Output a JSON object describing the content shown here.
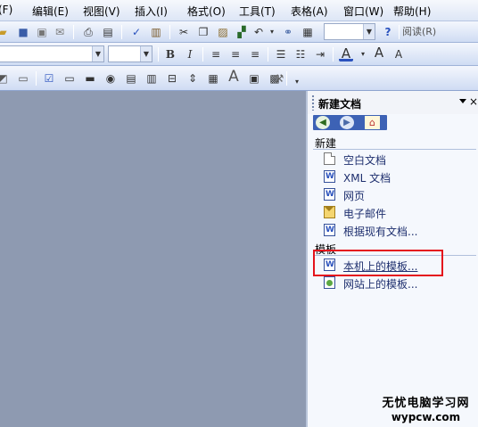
{
  "menubar": {
    "items": [
      {
        "label": "(F)"
      },
      {
        "label": "编辑(E)"
      },
      {
        "label": "视图(V)"
      },
      {
        "label": "插入(I)"
      },
      {
        "label": "格式(O)"
      },
      {
        "label": "工具(T)"
      },
      {
        "label": "表格(A)"
      },
      {
        "label": "窗口(W)"
      },
      {
        "label": "帮助(H)"
      }
    ]
  },
  "toolbar_standard": {
    "zoom_value": "",
    "read_label": "阅读(R)"
  },
  "toolbar_format": {
    "style_value": "",
    "font_size_value": "",
    "bold": "B",
    "italic": "I",
    "font_color": "A",
    "grow_font": "A",
    "shrink_font": "A"
  },
  "toolbar_forms": {
    "text_symbol": "A"
  },
  "task_pane": {
    "title": "新建文档",
    "close": "×",
    "section_new": "新建",
    "new_items": [
      {
        "label": "空白文档",
        "icon": "blank-document-icon"
      },
      {
        "label": "XML 文档",
        "icon": "xml-document-icon"
      },
      {
        "label": "网页",
        "icon": "web-page-icon"
      },
      {
        "label": "电子邮件",
        "icon": "email-icon"
      },
      {
        "label": "根据现有文档...",
        "icon": "existing-document-icon"
      }
    ],
    "section_templates": "模板",
    "template_items": [
      {
        "label": "本机上的模板...",
        "icon": "local-template-icon"
      },
      {
        "label": "网站上的模板...",
        "icon": "web-template-icon"
      }
    ]
  },
  "watermark": {
    "line1": "无忧电脑学习网",
    "line2": "wypcw.com"
  },
  "colors": {
    "highlight_border": "#e4131c",
    "nav_bar": "#3d62b5"
  }
}
